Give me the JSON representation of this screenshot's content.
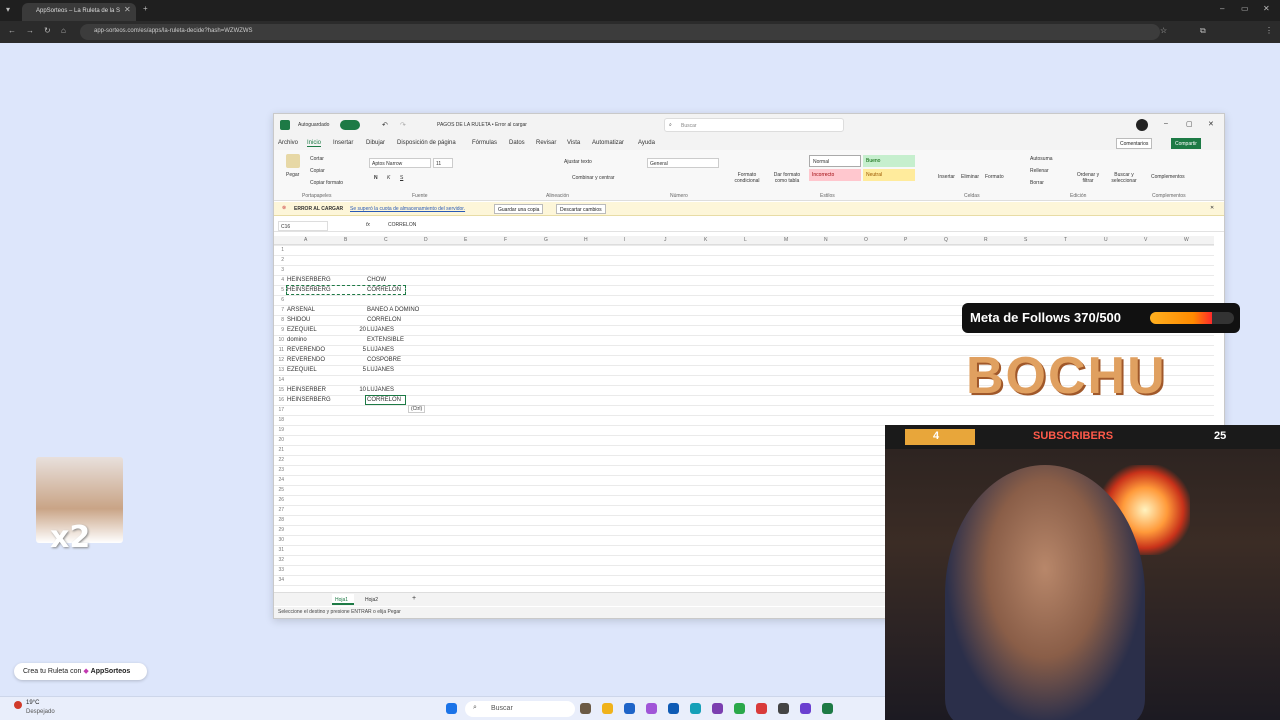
{
  "browser": {
    "tab_title": "AppSorteos – La Ruleta de la S",
    "url": "app-sorteos.com/es/apps/la-ruleta-decide?hash=WZWZWS"
  },
  "excel": {
    "autosave_label": "Autoguardado",
    "file_title": "PAGOS DE LA RULETA • Error al cargar",
    "search_placeholder": "Buscar",
    "comments_label": "Comentarios",
    "share_label": "Compartir",
    "menu": [
      "Archivo",
      "Inicio",
      "Insertar",
      "Dibujar",
      "Disposición de página",
      "Fórmulas",
      "Datos",
      "Revisar",
      "Vista",
      "Automatizar",
      "Ayuda"
    ],
    "ribbon": {
      "paste": "Pegar",
      "cut": "Cortar",
      "copy": "Copiar",
      "format_painter": "Copiar formato",
      "font_name": "Aptos Narrow",
      "font_size": "11",
      "wrap_text": "Ajustar texto",
      "merge_center": "Combinar y centrar",
      "number_format": "General",
      "conditional_format": "Formato condicional",
      "format_as_table": "Dar formato como tabla",
      "style_normal": "Normal",
      "style_good": "Bueno",
      "style_bad": "Incorrecto",
      "style_neutral": "Neutral",
      "insert": "Insertar",
      "delete": "Eliminar",
      "format": "Formato",
      "autosum": "Autosuma",
      "fill": "Rellenar",
      "clear": "Borrar",
      "sort_filter": "Ordenar y filtrar",
      "find_select": "Buscar y seleccionar",
      "addins": "Complementos",
      "group_clipboard": "Portapapeles",
      "group_font": "Fuente",
      "group_alignment": "Alineación",
      "group_number": "Número",
      "group_styles": "Estilos",
      "group_cells": "Celdas",
      "group_editing": "Edición",
      "group_addins": "Complementos"
    },
    "error_bar": {
      "title": "ERROR AL CARGAR",
      "message": "Se superó la cuota de almacenamiento del servidor.",
      "save_copy": "Guardar una copia",
      "discard": "Descartar cambios"
    },
    "name_box": "C16",
    "formula_value": "CORRELON",
    "columns": [
      "A",
      "B",
      "C",
      "D",
      "E",
      "F",
      "G",
      "H",
      "I",
      "J",
      "K",
      "L",
      "M",
      "N",
      "O",
      "P",
      "Q",
      "R",
      "S",
      "T",
      "U",
      "V",
      "W"
    ],
    "cells": [
      {
        "row": 4,
        "a": "HEINSERBERG",
        "b": "",
        "c": "CHOW"
      },
      {
        "row": 5,
        "a": "HEINSERBERG",
        "b": "",
        "c": "CORRELON"
      },
      {
        "row": 7,
        "a": "ARSENAL",
        "b": "",
        "c": "BANEO A DOMINO"
      },
      {
        "row": 8,
        "a": "SHIDOU",
        "b": "",
        "c": "CORRELON"
      },
      {
        "row": 9,
        "a": "EZEQUIEL",
        "b": "20",
        "c": "LUJANES"
      },
      {
        "row": 10,
        "a": "domino",
        "b": "",
        "c": "EXTENSIBLE"
      },
      {
        "row": 11,
        "a": "REVERENDO",
        "b": "5",
        "c": "LUJANES"
      },
      {
        "row": 12,
        "a": "REVERENDO",
        "b": "",
        "c": "COSPOBRE"
      },
      {
        "row": 13,
        "a": "EZEQUIEL",
        "b": "5",
        "c": "LUJANES"
      },
      {
        "row": 15,
        "a": "HEINSERBER",
        "b": "10",
        "c": "LUJANES"
      },
      {
        "row": 16,
        "a": "HEINSERBERG",
        "b": "",
        "c": "CORRELON"
      }
    ],
    "paste_tag": "(Ctrl)",
    "sheet_tabs": [
      "Hoja1",
      "Hoja2"
    ],
    "status_text": "Seleccione el destino y presione ENTRAR o elija Pegar"
  },
  "overlay": {
    "follow_goal": "Meta de Follows 370/500",
    "follow_progress": 0.74,
    "logo_text": "BOCHU",
    "sub_left_count": "4",
    "sub_label": "SUBSCRIBERS",
    "sub_right_count": "25",
    "multiplier": "x2",
    "ruleta_label": "Crea tu Ruleta con",
    "ruleta_brand": "AppSorteos"
  },
  "taskbar": {
    "weather_temp": "19°C",
    "weather_desc": "Despejado",
    "search": "Buscar"
  }
}
